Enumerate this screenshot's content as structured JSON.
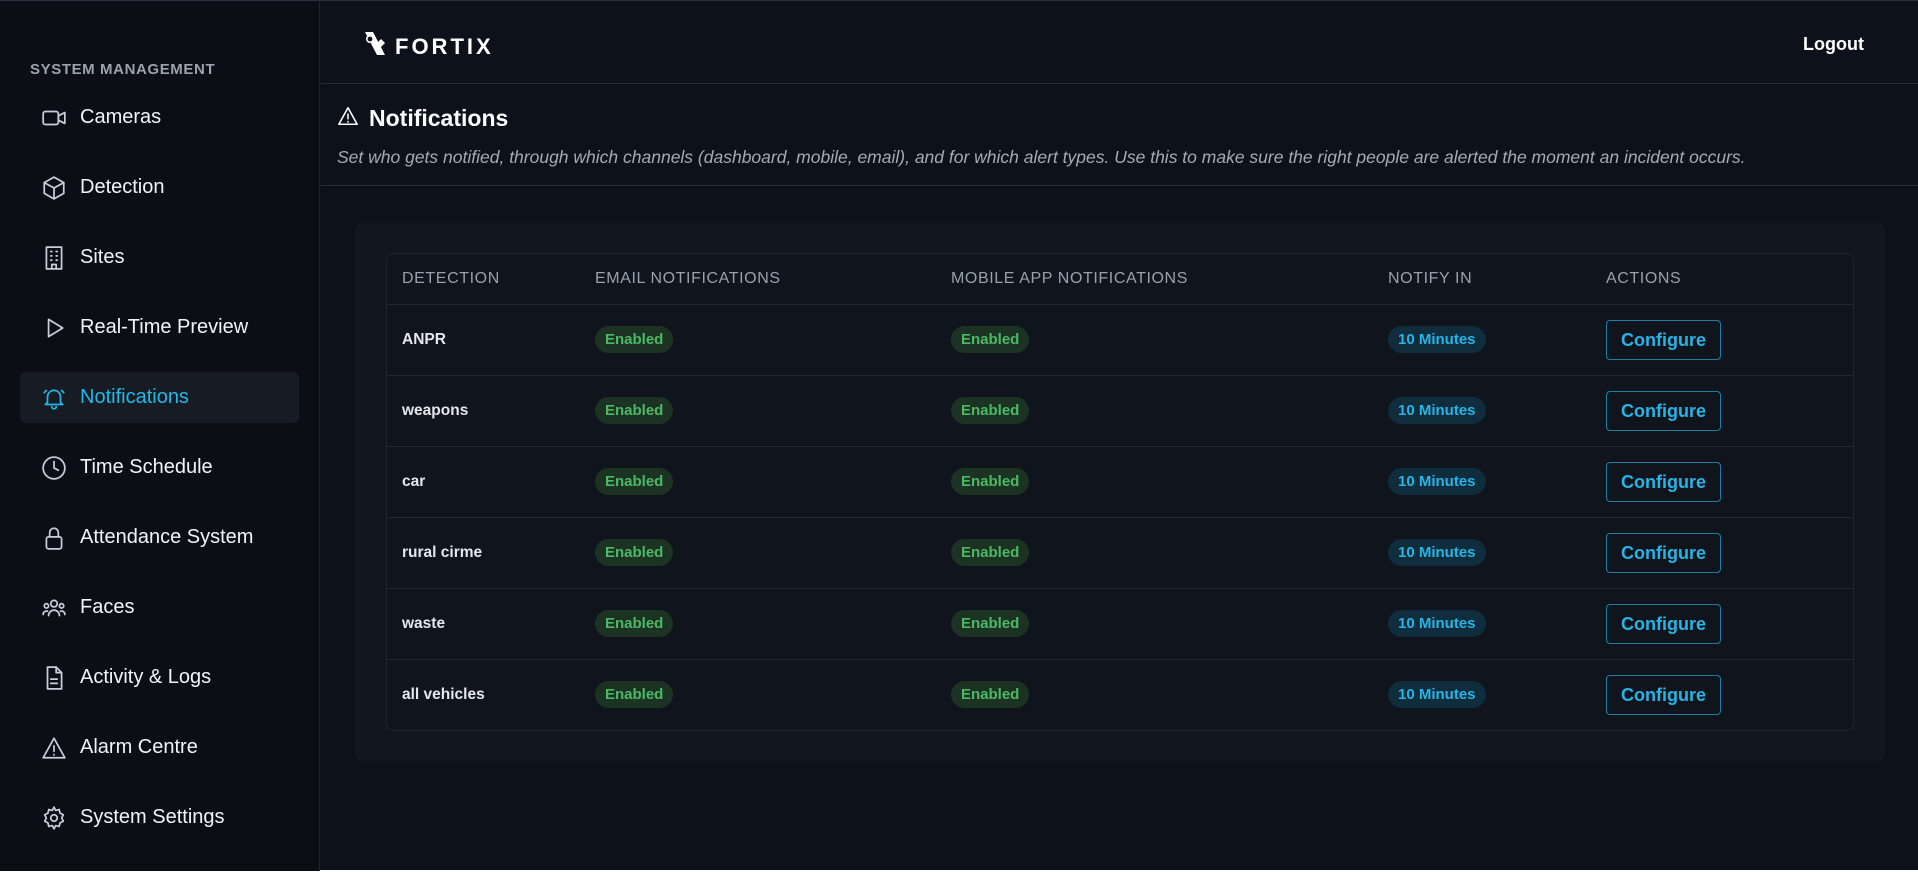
{
  "sidebar": {
    "heading": "SYSTEM MANAGEMENT",
    "items": [
      {
        "label": "Cameras",
        "icon": "camera-icon",
        "active": false
      },
      {
        "label": "Detection",
        "icon": "cube-icon",
        "active": false
      },
      {
        "label": "Sites",
        "icon": "building-icon",
        "active": false
      },
      {
        "label": "Real-Time Preview",
        "icon": "play-icon",
        "active": false
      },
      {
        "label": "Notifications",
        "icon": "bell-icon",
        "active": true
      },
      {
        "label": "Time Schedule",
        "icon": "clock-icon",
        "active": false
      },
      {
        "label": "Attendance System",
        "icon": "lock-icon",
        "active": false
      },
      {
        "label": "Faces",
        "icon": "users-icon",
        "active": false
      },
      {
        "label": "Activity & Logs",
        "icon": "document-icon",
        "active": false
      },
      {
        "label": "Alarm Centre",
        "icon": "warning-icon",
        "active": false
      },
      {
        "label": "System Settings",
        "icon": "gear-icon",
        "active": false
      }
    ]
  },
  "header": {
    "logo_text": "FORTIX",
    "logout_label": "Logout"
  },
  "page": {
    "title": "Notifications",
    "description": "Set who gets notified, through which channels (dashboard, mobile, email), and for which alert types. Use this to make sure the right people are alerted the moment an incident occurs."
  },
  "table": {
    "columns": [
      "DETECTION",
      "EMAIL NOTIFICATIONS",
      "MOBILE APP NOTIFICATIONS",
      "NOTIFY IN",
      "ACTIONS"
    ],
    "rows": [
      {
        "detection": "ANPR",
        "email": "Enabled",
        "mobile": "Enabled",
        "notify_in": "10 Minutes",
        "action": "Configure"
      },
      {
        "detection": "weapons",
        "email": "Enabled",
        "mobile": "Enabled",
        "notify_in": "10 Minutes",
        "action": "Configure"
      },
      {
        "detection": "car",
        "email": "Enabled",
        "mobile": "Enabled",
        "notify_in": "10 Minutes",
        "action": "Configure"
      },
      {
        "detection": "rural cirme",
        "email": "Enabled",
        "mobile": "Enabled",
        "notify_in": "10 Minutes",
        "action": "Configure"
      },
      {
        "detection": "waste",
        "email": "Enabled",
        "mobile": "Enabled",
        "notify_in": "10 Minutes",
        "action": "Configure"
      },
      {
        "detection": "all vehicles",
        "email": "Enabled",
        "mobile": "Enabled",
        "notify_in": "10 Minutes",
        "action": "Configure"
      }
    ]
  },
  "colors": {
    "accent": "#22b8e6",
    "enabled_text": "#4cb866",
    "background": "#0d111a"
  }
}
